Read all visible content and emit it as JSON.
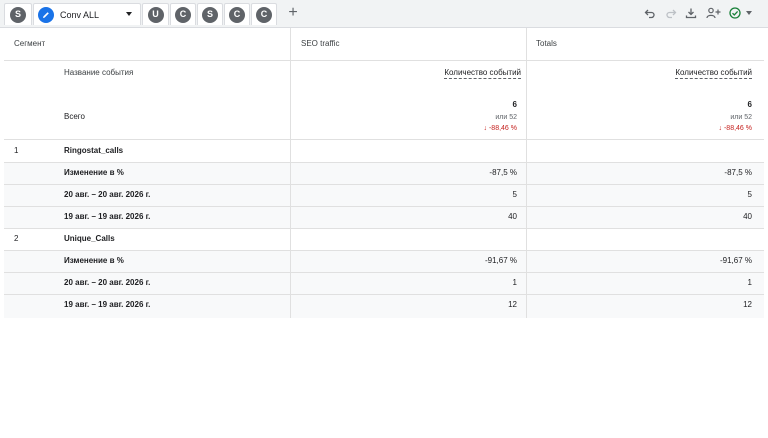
{
  "toolbar": {
    "segments": [
      {
        "letter": "S",
        "active": false
      },
      {
        "letter": "",
        "label": "Conv ALL",
        "active": true
      },
      {
        "letter": "U",
        "active": false
      },
      {
        "letter": "C",
        "active": false
      },
      {
        "letter": "S",
        "active": false
      },
      {
        "letter": "C",
        "active": false
      },
      {
        "letter": "C",
        "active": false
      }
    ],
    "add_icon": "plus-icon",
    "actions": [
      "undo-icon",
      "redo-icon",
      "download-icon",
      "share-user-icon",
      "check-circle-icon"
    ]
  },
  "table": {
    "headers": {
      "segment": "Сегмент",
      "col1": "SEO traffic",
      "col2": "Totals"
    },
    "dimension_label": "Название события",
    "metric_label": "Количество событий",
    "total": {
      "label": "Всего",
      "col1": {
        "value": "6",
        "compare": "или 52",
        "change": "↓ -88,46 %"
      },
      "col2": {
        "value": "6",
        "compare": "или 52",
        "change": "↓ -88,46 %"
      }
    },
    "groups": [
      {
        "index": "1",
        "name": "Ringostat_calls",
        "rows": [
          {
            "label": "Изменение в %",
            "col1": "-87,5 %",
            "col2": "-87,5 %"
          },
          {
            "label": "20 авг. – 20 авг. 2026 г.",
            "col1": "5",
            "col2": "5"
          },
          {
            "label": "19 авг. – 19 авг. 2026 г.",
            "col1": "40",
            "col2": "40"
          }
        ]
      },
      {
        "index": "2",
        "name": "Unique_Calls",
        "rows": [
          {
            "label": "Изменение в %",
            "col1": "-91,67 %",
            "col2": "-91,67 %"
          },
          {
            "label": "20 авг. – 20 авг. 2026 г.",
            "col1": "1",
            "col2": "1"
          },
          {
            "label": "19 авг. – 19 авг. 2026 г.",
            "col1": "12",
            "col2": "12"
          }
        ]
      }
    ]
  },
  "colors": {
    "accent": "#1a73e8",
    "negative": "#c5221f",
    "badge": "#5f6368",
    "check": "#188038"
  }
}
